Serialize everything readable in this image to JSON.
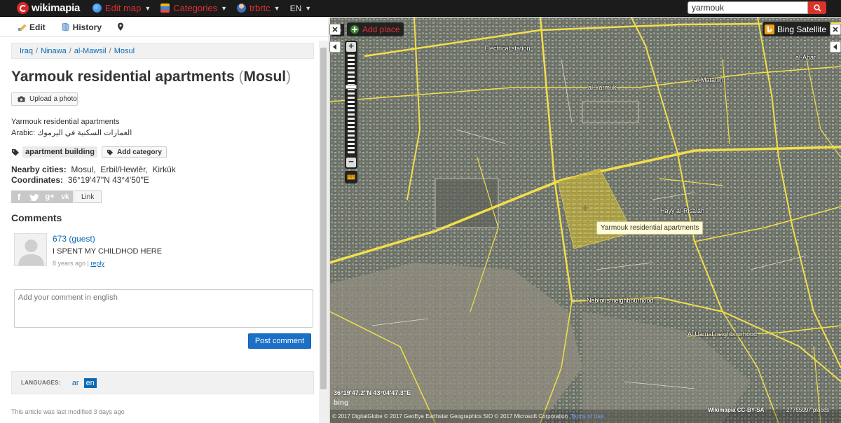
{
  "topbar": {
    "logo": "wikimapia",
    "menu": [
      {
        "label": "Edit map",
        "icon": "globe-icon"
      },
      {
        "label": "Categories",
        "icon": "categories-icon"
      },
      {
        "label": "trbrtc",
        "icon": "user-icon"
      }
    ],
    "language": "EN",
    "search_value": "yarmouk"
  },
  "panel": {
    "toolbar": {
      "edit": "Edit",
      "history": "History"
    },
    "breadcrumb": [
      "Iraq",
      "Ninawa",
      "al-Mawsil",
      "Mosul"
    ],
    "title_main": "Yarmouk residential apartments",
    "title_city": "Mosul",
    "upload_label": "Upload a photo",
    "description_line1": "Yarmouk residential apartments",
    "description_line2": "Arabic: العمارات السكنية في اليرموك",
    "tag": "apartment building",
    "add_category": "Add category",
    "nearby_label": "Nearby cities:",
    "nearby_cities": "Mosul,  Erbil/Hewlêr,  Kirkûk",
    "coordinates_label": "Coordinates:",
    "coordinates": "36°19'47\"N 43°4'50\"E",
    "link_label": "Link",
    "comments_header": "Comments",
    "comment": {
      "author": "673 (guest)",
      "text": "I SPENT MY CHILDHOD HERE",
      "time": "8 years ago",
      "reply": "reply"
    },
    "comment_placeholder": "Add your comment in english",
    "post_label": "Post comment",
    "languages_label": "LANGUAGES:",
    "languages": [
      "ar",
      "en"
    ],
    "active_language": "en",
    "modified": "This article was last modified 3 days ago"
  },
  "map": {
    "add_place": "Add place",
    "layer": "Bing Satellite",
    "labels": {
      "electrical_station": "Electrical station",
      "al_yarmuk": "al-Yarmuk",
      "al_matahin": "al-Matahin",
      "al_abar": "al-Abar",
      "hayy_al_risalah": "Hayy al-Risalah",
      "nablous": "Nablous neighbourhood",
      "al_uamal": "Al Uamal neighbourhood"
    },
    "tooltip": "Yarmouk residential apartments",
    "cursor_coords": "36°19'47.2\"N 43°04'47.3\"E",
    "bing": "bing",
    "copyright": "© 2017 DigitalGlobe © 2017 GeoEye Earthstar Geographics SIO © 2017 Microsoft Corporation",
    "terms": "Terms of Use",
    "credit": "Wikimapia CC-BY-SA",
    "place_count": "27755997 places"
  },
  "colors": {
    "brand_red": "#d62828",
    "link_blue": "#0a6bb5",
    "road_yellow": "#f2de4a",
    "highlight": "#e0c62a"
  }
}
